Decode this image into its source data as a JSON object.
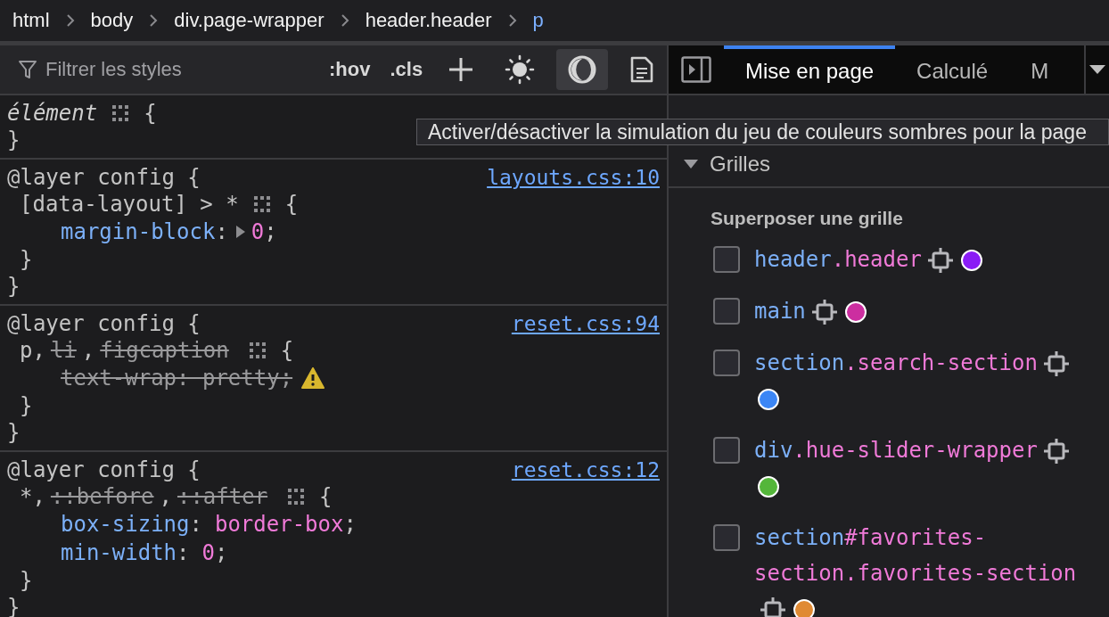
{
  "breadcrumb": [
    {
      "label": "html",
      "selected": false
    },
    {
      "label": "body",
      "selected": false
    },
    {
      "label": "div.page-wrapper",
      "selected": false
    },
    {
      "label": "header.header",
      "selected": false
    },
    {
      "label": "p",
      "selected": true
    }
  ],
  "styles_toolbar": {
    "filter": {
      "placeholder": "Filtrer les styles"
    },
    "buttons": [
      {
        "kind": "text",
        "label": ":hov",
        "pressed": false
      },
      {
        "kind": "text",
        "label": ".cls",
        "pressed": false
      },
      {
        "kind": "plus",
        "pressed": false
      },
      {
        "kind": "sun",
        "pressed": false
      },
      {
        "kind": "moon",
        "pressed": true
      },
      {
        "kind": "document",
        "pressed": false
      }
    ]
  },
  "rules": [
    {
      "lines": [
        {
          "kind": "selector-top",
          "tokens": [
            {
              "kind": "italic",
              "text": "élément"
            },
            {
              "kind": "grid-icon"
            },
            {
              "kind": "plain",
              "text": "{"
            }
          ]
        },
        {
          "kind": "at-rule-end",
          "tokens": [
            {
              "kind": "plain",
              "text": "}"
            }
          ]
        }
      ]
    },
    {
      "source": "layouts.css:10",
      "lines": [
        {
          "kind": "at-rule",
          "tokens": [
            {
              "kind": "plain",
              "text": "@layer config {"
            }
          ]
        },
        {
          "kind": "selector",
          "tokens": [
            {
              "kind": "plain",
              "text": "[data-layout] > *"
            },
            {
              "kind": "grid-icon"
            },
            {
              "kind": "plain",
              "text": "{"
            }
          ]
        },
        {
          "kind": "declaration",
          "tokens": [
            {
              "kind": "property",
              "text": "margin-block"
            },
            {
              "kind": "plain",
              "text": ":"
            },
            {
              "kind": "expander-icon"
            },
            {
              "kind": "value",
              "text": "0"
            },
            {
              "kind": "plain",
              "text": ";"
            }
          ]
        },
        {
          "kind": "rule-end",
          "tokens": [
            {
              "kind": "plain",
              "text": "}"
            }
          ]
        },
        {
          "kind": "at-rule-end",
          "tokens": [
            {
              "kind": "plain",
              "text": "}"
            }
          ]
        }
      ]
    },
    {
      "source": "reset.css:94",
      "lines": [
        {
          "kind": "at-rule",
          "tokens": [
            {
              "kind": "plain",
              "text": "@layer config {"
            }
          ]
        },
        {
          "kind": "selector",
          "tokens": [
            {
              "kind": "plain",
              "text": "p,"
            },
            {
              "kind": "struck",
              "text": "li"
            },
            {
              "kind": "plain",
              "text": ","
            },
            {
              "kind": "struck",
              "text": "figcaption"
            },
            {
              "kind": "grid-icon"
            },
            {
              "kind": "plain",
              "text": "{"
            }
          ]
        },
        {
          "kind": "declaration",
          "tokens": [
            {
              "kind": "struck",
              "text": "text-wrap: pretty;"
            },
            {
              "kind": "warning-icon"
            }
          ]
        },
        {
          "kind": "rule-end",
          "tokens": [
            {
              "kind": "plain",
              "text": "}"
            }
          ]
        },
        {
          "kind": "at-rule-end",
          "tokens": [
            {
              "kind": "plain",
              "text": "}"
            }
          ]
        }
      ]
    },
    {
      "source": "reset.css:12",
      "lines": [
        {
          "kind": "at-rule",
          "tokens": [
            {
              "kind": "plain",
              "text": "@layer config {"
            }
          ]
        },
        {
          "kind": "selector",
          "tokens": [
            {
              "kind": "plain",
              "text": "*,"
            },
            {
              "kind": "struck",
              "text": "::before"
            },
            {
              "kind": "plain",
              "text": ","
            },
            {
              "kind": "struck",
              "text": "::after"
            },
            {
              "kind": "grid-icon"
            },
            {
              "kind": "plain",
              "text": "{"
            }
          ]
        },
        {
          "kind": "declaration",
          "tokens": [
            {
              "kind": "property",
              "text": "box-sizing"
            },
            {
              "kind": "plain",
              "text": ":"
            },
            {
              "kind": "value",
              "text": "border-box"
            },
            {
              "kind": "plain",
              "text": ";"
            }
          ]
        },
        {
          "kind": "declaration",
          "tokens": [
            {
              "kind": "property",
              "text": "min-width"
            },
            {
              "kind": "plain",
              "text": ":"
            },
            {
              "kind": "value",
              "text": "0"
            },
            {
              "kind": "plain",
              "text": ";"
            }
          ]
        },
        {
          "kind": "rule-end",
          "tokens": [
            {
              "kind": "plain",
              "text": "}"
            }
          ]
        },
        {
          "kind": "at-rule-end",
          "tokens": [
            {
              "kind": "plain",
              "text": "}"
            }
          ]
        }
      ]
    }
  ],
  "layout_tabs": [
    {
      "label": "Mise en page",
      "selected": true
    },
    {
      "label": "Calculé",
      "selected": false
    },
    {
      "label": "M",
      "selected": false
    }
  ],
  "sections": [
    {
      "title": "Grilles",
      "expanded": true
    }
  ],
  "grid_overlay": {
    "heading": "Superposer une grille",
    "items": [
      {
        "tag": "header",
        "rest": ".header",
        "checked": false,
        "color": "#8a1cf5"
      },
      {
        "tag": "main",
        "checked": false,
        "color": "#cc2ea0"
      },
      {
        "tag": "section",
        "rest": ".search-section",
        "checked": false,
        "color": "#3b86f6"
      },
      {
        "tag": "div",
        "rest": ".hue-slider-wrapper",
        "checked": false,
        "color": "#54b63a"
      },
      {
        "tag": "section",
        "rest": "#favorites-section.favorites-section",
        "checked": false,
        "color": "#e08a34"
      }
    ]
  },
  "tooltip": "Activer/désactiver la simulation du jeu de couleurs sombres pour la page"
}
